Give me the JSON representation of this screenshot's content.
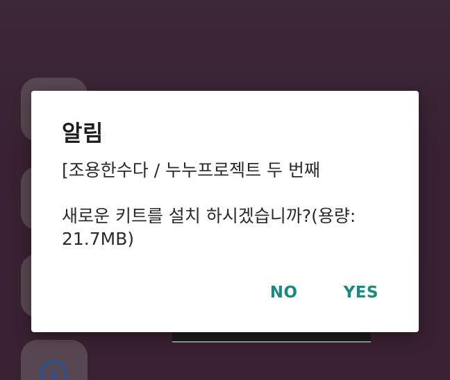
{
  "dialog": {
    "title": "알림",
    "message": "[조용한수다 / 누누프로젝트 두 번째\n\n새로운 키트를 설치 하시겠습니까?(용량: 21.7MB)",
    "buttons": {
      "no": "NO",
      "yes": "YES"
    }
  },
  "colors": {
    "button_text": "#1a8a7e",
    "background": "#3b2233",
    "info_icon": "#1f57a6"
  },
  "icons": {
    "background_info": "info-icon"
  }
}
